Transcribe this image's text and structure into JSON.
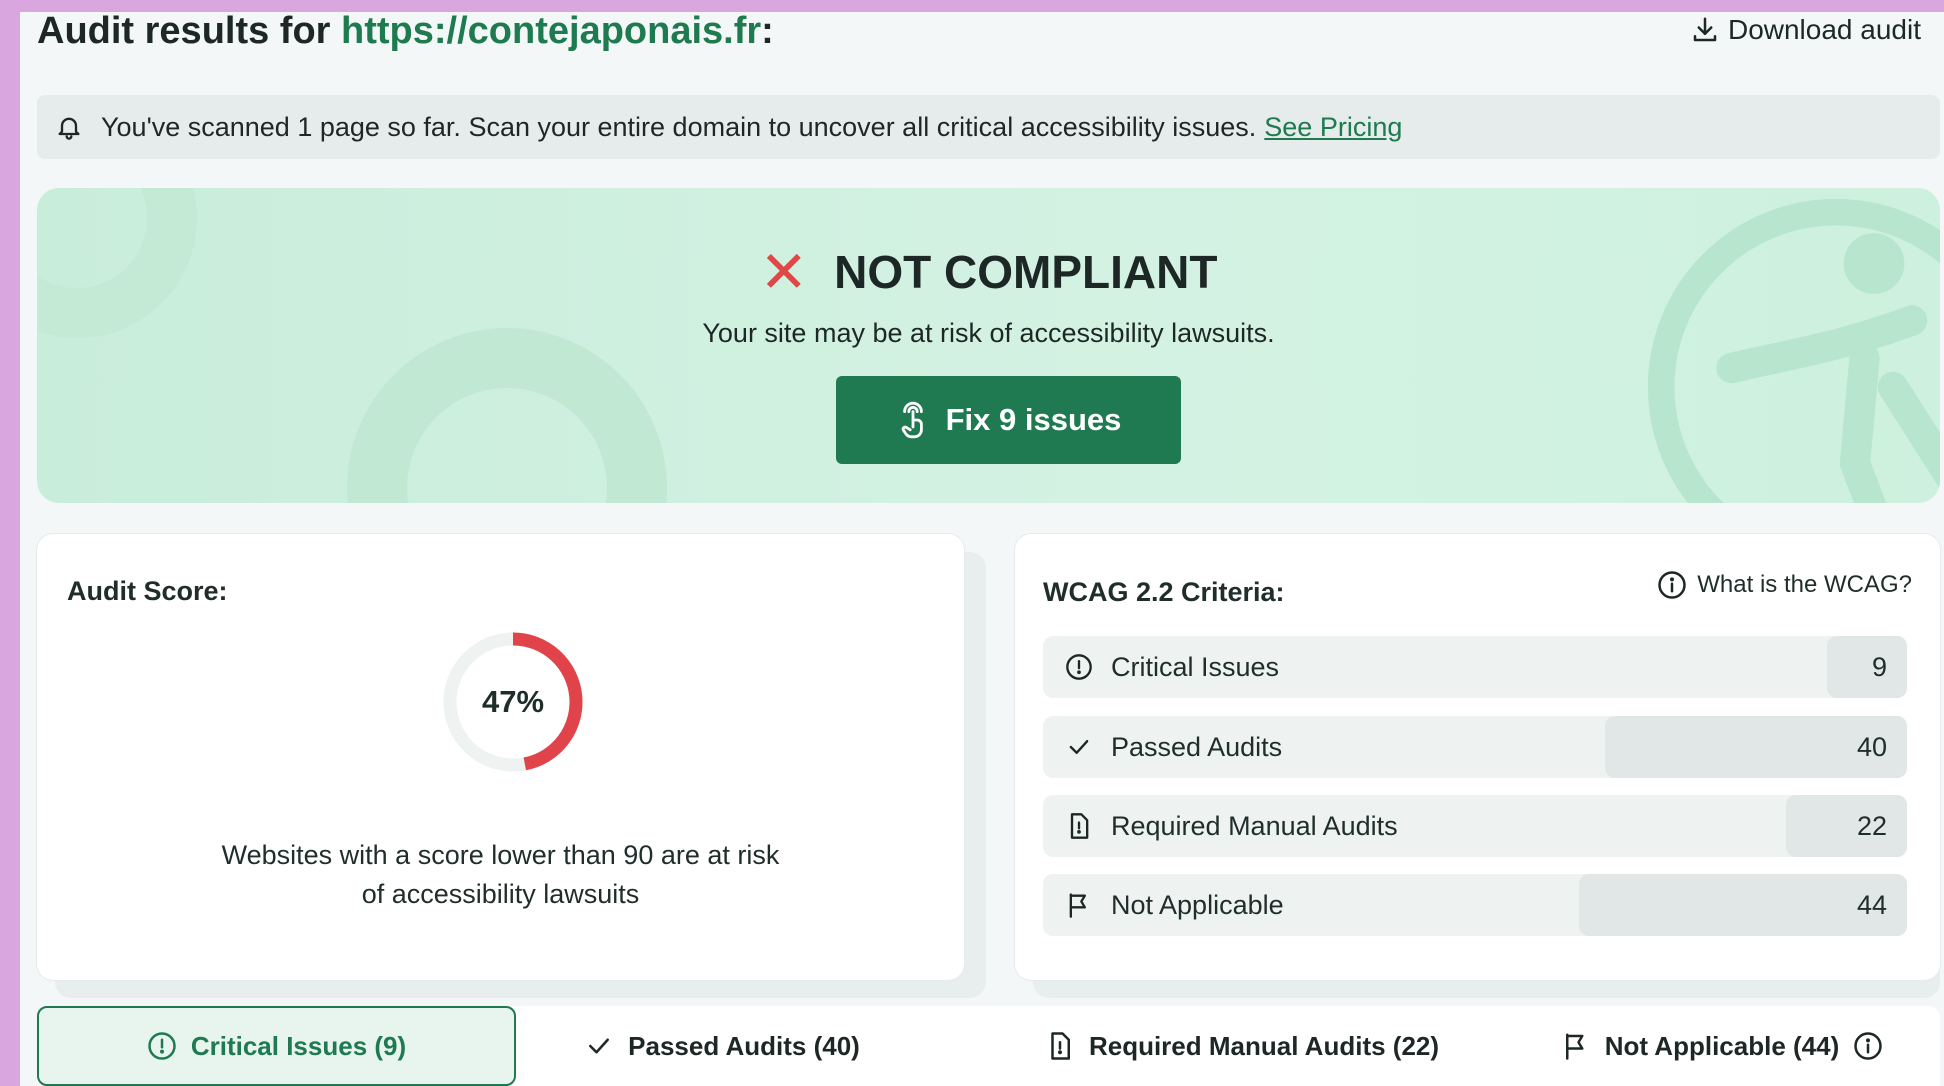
{
  "header": {
    "title_prefix": "Audit results for ",
    "url": "https://contejaponais.fr",
    "title_suffix": ":",
    "download_label": "Download audit"
  },
  "notice": {
    "text": "You've scanned 1 page so far. Scan your entire domain to uncover all critical accessibility issues.",
    "link_label": "See Pricing"
  },
  "hero": {
    "status": "NOT COMPLIANT",
    "subtitle": "Your site may be at risk of accessibility lawsuits.",
    "fix_button_label": "Fix 9 issues"
  },
  "score": {
    "label": "Audit Score:",
    "value_text": "47%",
    "value": 0.47,
    "note_line1": "Websites with a score lower than 90 are at risk",
    "note_line2": "of accessibility lawsuits",
    "colors": {
      "arc": "#e0444a",
      "track": "#eef2f1"
    }
  },
  "wcag": {
    "label": "WCAG 2.2 Criteria:",
    "help_label": "What is the WCAG?",
    "rows": [
      {
        "label": "Critical Issues",
        "count": "9",
        "icon": "alert-circle-icon",
        "fraction": 0.09
      },
      {
        "label": "Passed Audits",
        "count": "40",
        "icon": "check-icon",
        "fraction": 0.35
      },
      {
        "label": "Required Manual Audits",
        "count": "22",
        "icon": "document-alert-icon",
        "fraction": 0.14
      },
      {
        "label": "Not Applicable",
        "count": "44",
        "icon": "flag-icon",
        "fraction": 0.38
      }
    ]
  },
  "tabs": [
    {
      "label": "Critical Issues (9)",
      "active": true
    },
    {
      "label": "Passed Audits (40)",
      "active": false
    },
    {
      "label": "Required Manual Audits (22)",
      "active": false
    },
    {
      "label": "Not Applicable (44)",
      "active": false
    }
  ],
  "colors": {
    "brand_green": "#1f7a52",
    "danger_red": "#e04848",
    "hero_bg": "#cdefdd"
  }
}
